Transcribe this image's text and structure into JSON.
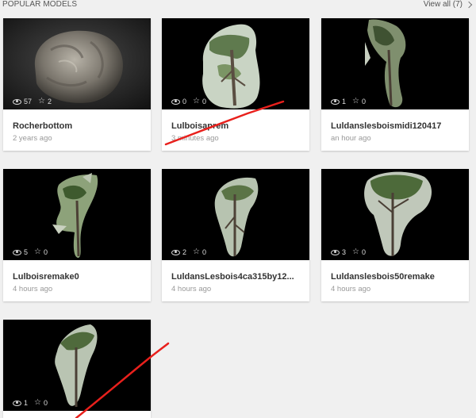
{
  "header": {
    "title": "POPULAR MODELS",
    "view_all": "View all (7)"
  },
  "models": [
    {
      "title": "Rocherbottom",
      "time": "2 years ago",
      "views": "57",
      "likes": "2"
    },
    {
      "title": "Lulboisaprem",
      "time": "3 minutes ago",
      "views": "0",
      "likes": "0"
    },
    {
      "title": "Luldanslesboismidi120417",
      "time": "an hour ago",
      "views": "1",
      "likes": "0"
    },
    {
      "title": "Lulboisremake0",
      "time": "4 hours ago",
      "views": "5",
      "likes": "0"
    },
    {
      "title": "LuldansLesbois4ca315by12...",
      "time": "4 hours ago",
      "views": "2",
      "likes": "0"
    },
    {
      "title": "Luldanslesbois50remake",
      "time": "4 hours ago",
      "views": "3",
      "likes": "0"
    },
    {
      "title": "",
      "time": "",
      "views": "1",
      "likes": "0"
    }
  ],
  "annotations": {
    "stroke_color": "#e8201c"
  }
}
